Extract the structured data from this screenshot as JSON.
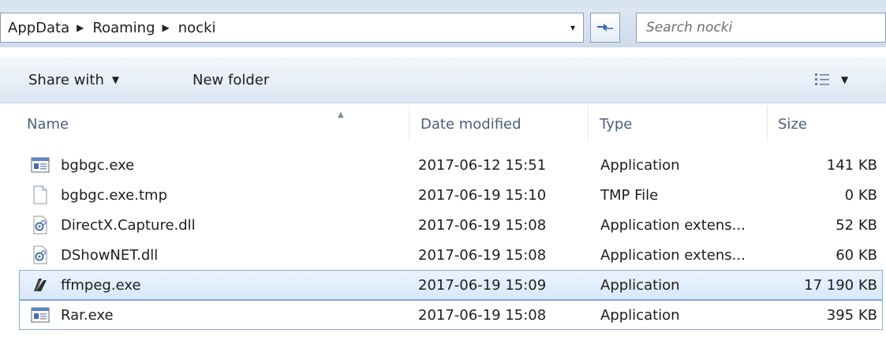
{
  "address": {
    "crumbs": [
      "AppData",
      "Roaming",
      "nocki"
    ],
    "dropdown_glyph": "▾"
  },
  "search": {
    "placeholder": "Search nocki"
  },
  "toolbar": {
    "share_label": "Share with",
    "share_caret": "▼",
    "new_folder_label": "New folder",
    "view_caret": "▼"
  },
  "columns": {
    "name": "Name",
    "date": "Date modified",
    "type": "Type",
    "size": "Size"
  },
  "files": [
    {
      "name": "bgbgc.exe",
      "date": "2017-06-12 15:51",
      "type": "Application",
      "size": "141 KB",
      "icon": "application-window-icon"
    },
    {
      "name": "bgbgc.exe.tmp",
      "date": "2017-06-19 15:10",
      "type": "TMP File",
      "size": "0 KB",
      "icon": "blank-file-icon"
    },
    {
      "name": "DirectX.Capture.dll",
      "date": "2017-06-19 15:08",
      "type": "Application extens...",
      "size": "52 KB",
      "icon": "dll-gear-icon"
    },
    {
      "name": "DShowNET.dll",
      "date": "2017-06-19 15:08",
      "type": "Application extens...",
      "size": "60 KB",
      "icon": "dll-gear-icon"
    },
    {
      "name": "ffmpeg.exe",
      "date": "2017-06-19 15:09",
      "type": "Application",
      "size": "17 190 KB",
      "icon": "ffmpeg-logo-icon",
      "selected": true
    },
    {
      "name": "Rar.exe",
      "date": "2017-06-19 15:08",
      "type": "Application",
      "size": "395 KB",
      "icon": "application-window-icon",
      "focused": true
    }
  ]
}
